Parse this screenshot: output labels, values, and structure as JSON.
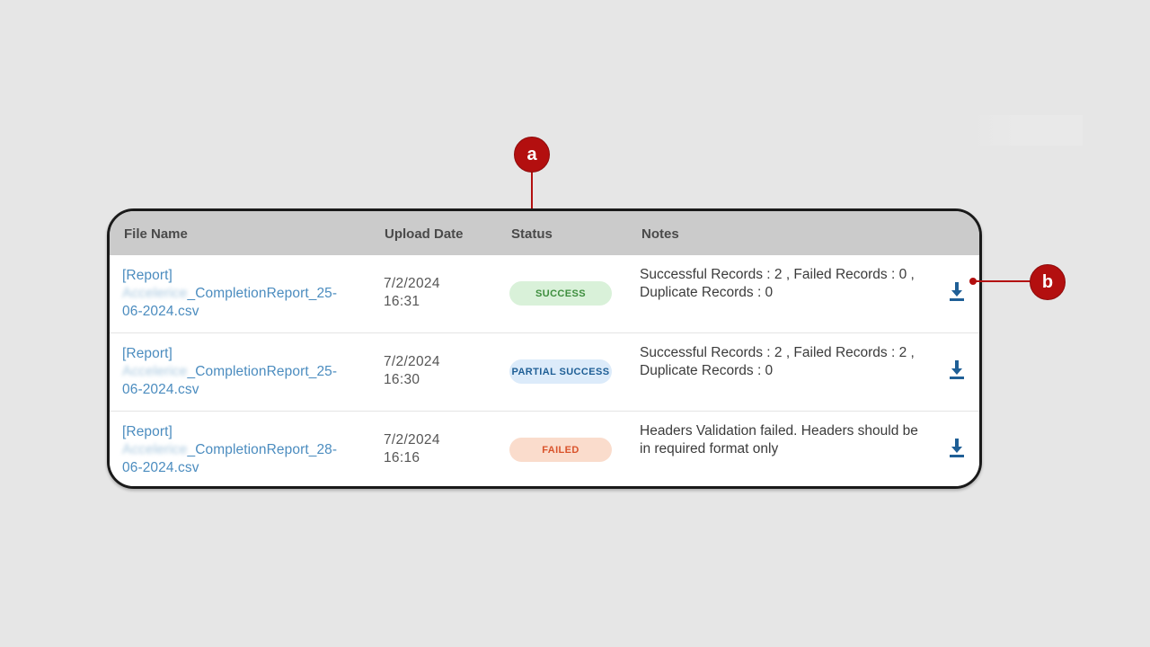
{
  "table": {
    "headers": {
      "file_name": "File Name",
      "upload_date": "Upload Date",
      "status": "Status",
      "notes": "Notes"
    },
    "rows": [
      {
        "file_prefix": "[Report]",
        "file_blurred": "Accelerice",
        "file_rest": "_CompletionReport_25-",
        "file_end": "06-2024.csv",
        "date": "7/2/2024",
        "time": "16:31",
        "status": "SUCCESS",
        "notes_line1": "Successful Records : 2 , Failed Records : 0 ,",
        "notes_line2": "Duplicate Records : 0"
      },
      {
        "file_prefix": "[Report]",
        "file_blurred": "Accelerice",
        "file_rest": "_CompletionReport_25-",
        "file_end": "06-2024.csv",
        "date": "7/2/2024",
        "time": "16:30",
        "status": "PARTIAL SUCCESS",
        "notes_line1": "Successful Records : 2 , Failed Records : 2 ,",
        "notes_line2": "Duplicate Records : 0"
      },
      {
        "file_prefix": "[Report]",
        "file_blurred": "Accelerice",
        "file_rest": "_CompletionReport_28-",
        "file_end": "06-2024.csv",
        "date": "7/2/2024",
        "time": "16:16",
        "status": "FAILED",
        "notes_line1": "Headers Validation failed. Headers should be",
        "notes_line2": "in required format only"
      }
    ]
  },
  "callouts": {
    "a": "a",
    "b": "b"
  },
  "colors": {
    "link": "#4b8cbf",
    "success_bg": "#d9f1d9",
    "partial_bg": "#dcebfa",
    "failed_bg": "#fadccc",
    "callout": "#b30f0f",
    "download_icon": "#1f5f96"
  },
  "icons": {
    "download": "download-icon"
  }
}
